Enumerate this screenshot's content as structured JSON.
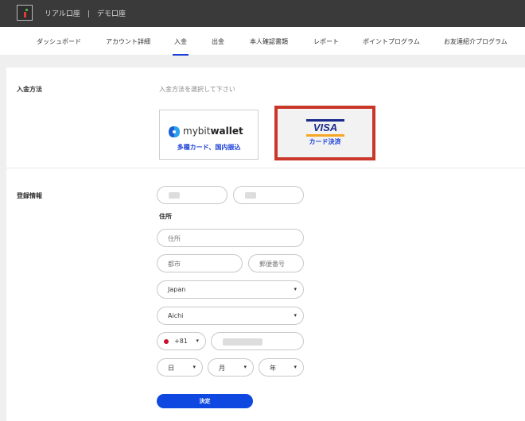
{
  "header": {
    "accounts": [
      "リアル口座",
      "デモ口座"
    ],
    "separator": "|"
  },
  "tabs": [
    {
      "label": "ダッシュボード"
    },
    {
      "label": "アカウント詳細"
    },
    {
      "label": "入金",
      "active": true
    },
    {
      "label": "出金"
    },
    {
      "label": "本人確認書類"
    },
    {
      "label": "レポート"
    },
    {
      "label": "ポイントプログラム"
    },
    {
      "label": "お友達紹介プログラム"
    }
  ],
  "deposit": {
    "section_label": "入金方法",
    "hint": "入金方法を選択して下さい",
    "methods": [
      {
        "logo_text_light": "mybit",
        "logo_text_bold": "wallet",
        "caption": "多種カード、国内振込",
        "icon": "mybit-wallet-logo"
      },
      {
        "logo_text": "VISA",
        "caption": "カード決済",
        "icon": "visa-logo",
        "selected": true
      }
    ]
  },
  "registration": {
    "section_label": "登録情報",
    "address_label": "住所",
    "address_placeholder": "住所",
    "city_placeholder": "都市",
    "postal_placeholder": "郵便番号",
    "country_value": "Japan",
    "prefecture_value": "Aichi",
    "phone_code": "+81",
    "day_label": "日",
    "month_label": "月",
    "year_label": "年",
    "submit_label": "決定"
  },
  "colors": {
    "topbar": "#3a3a3a",
    "accent": "#1b3fd6",
    "submit": "#0e48e0",
    "selected_border": "#c9372b"
  }
}
